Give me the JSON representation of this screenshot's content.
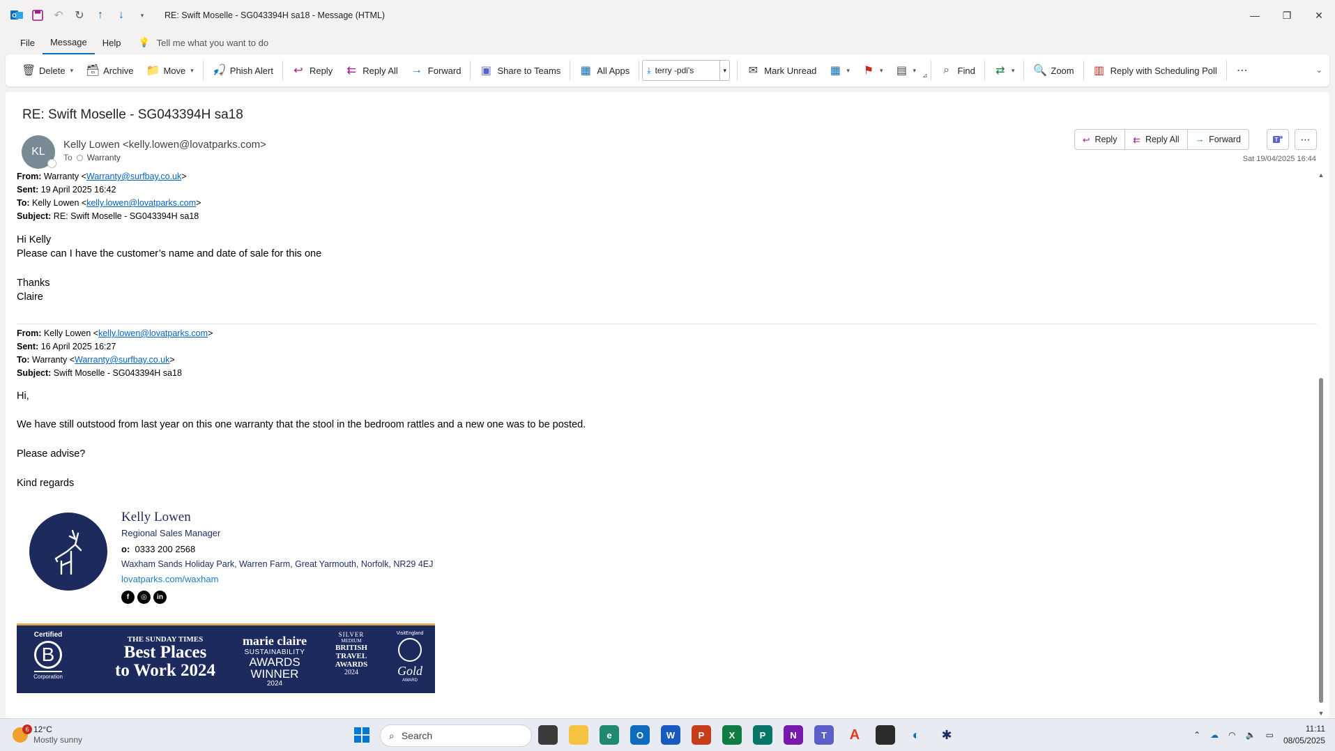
{
  "window": {
    "title": "RE: Swift Moselle - SG043394H sa18  -  Message (HTML)",
    "minimize": "—",
    "restore": "❐",
    "close": "✕"
  },
  "menu": {
    "file": "File",
    "message": "Message",
    "help": "Help",
    "tellme": "Tell me what you want to do"
  },
  "ribbon": {
    "delete": "Delete",
    "archive": "Archive",
    "move": "Move",
    "phish_alert": "Phish Alert",
    "reply": "Reply",
    "reply_all": "Reply All",
    "forward": "Forward",
    "share_teams": "Share to Teams",
    "all_apps": "All Apps",
    "quick_step": "terry -pdi's",
    "mark_unread": "Mark Unread",
    "find": "Find",
    "zoom": "Zoom",
    "scheduling_poll": "Reply with Scheduling Poll"
  },
  "message": {
    "subject": "RE: Swift Moselle - SG043394H sa18",
    "avatar_initials": "KL",
    "sender": "Kelly Lowen <kelly.lowen@lovatparks.com>",
    "to_label": "To",
    "to_recipient": "Warranty",
    "date": "Sat 19/04/2025 16:44",
    "actions": {
      "reply": "Reply",
      "reply_all": "Reply All",
      "forward": "Forward"
    }
  },
  "latest": {
    "from_label": "From:",
    "from_name": "Warranty <",
    "from_email": "Warranty@surfbay.co.uk",
    "from_close": ">",
    "sent_label": "Sent:",
    "sent": "19 April 2025 16:42",
    "to_label": "To:",
    "to_name": "Kelly Lowen <",
    "to_email": "kelly.lowen@lovatparks.com",
    "to_close": ">",
    "subject_label": "Subject:",
    "subject": "RE: Swift Moselle - SG043394H sa18",
    "greeting": "Hi Kelly",
    "line1": "Please can I have the customer’s name and date of sale for this one",
    "thanks": "Thanks",
    "signoff": "Claire"
  },
  "earlier": {
    "from_label": "From:",
    "from_name": "Kelly Lowen <",
    "from_email": "kelly.lowen@lovatparks.com",
    "from_close": ">",
    "sent_label": "Sent:",
    "sent": "16 April 2025 16:27",
    "to_label": "To:",
    "to_name": "Warranty <",
    "to_email": "Warranty@surfbay.co.uk",
    "to_close": ">",
    "subject_label": "Subject:",
    "subject": "Swift Moselle - SG043394H sa18",
    "greeting": "Hi,",
    "line1": "We have still outstood from last year on this one warranty that the stool in the bedroom rattles and a new one was to be posted.",
    "line2": "Please advise?",
    "regards": "Kind regards"
  },
  "signature": {
    "name": "Kelly Lowen",
    "role": "Regional Sales Manager",
    "phone_label": "o:",
    "phone": "0333 200 2568",
    "address": "Waxham Sands Holiday Park, Warren Farm, Great Yarmouth, Norfolk, NR29 4EJ",
    "web": "lovatparks.com/waxham",
    "social": [
      "f",
      "◎",
      "in"
    ]
  },
  "awards": {
    "bcorp_top": "Certified",
    "bcorp_bottom": "Corporation",
    "sunday_times_top": "THE SUNDAY TIMES",
    "sunday_times_main": "Best Places",
    "sunday_times_sub": "to Work 2024",
    "marie_claire": "marie claire",
    "mc_line1": "SUSTAINABILITY",
    "mc_line2": "AWARDS",
    "mc_line3": "WINNER",
    "mc_year": "2024",
    "btta_top": "SILVER",
    "btta_mid": "MEDIUM",
    "btta_line1": "BRITISH",
    "btta_line2": "TRAVEL",
    "btta_line3": "AWARDS",
    "btta_year": "2024",
    "visit_england": "VisitEngland",
    "gold": "Gold",
    "gold_sub": "AWARD"
  },
  "taskbar": {
    "temp": "12°C",
    "condition": "Mostly sunny",
    "weather_badge": "6",
    "search": "Search",
    "time": "11:11",
    "date": "08/05/2025"
  },
  "colors": {
    "accent": "#0f6cbd",
    "navy": "#1d2a5e",
    "link": "#0563c1"
  }
}
